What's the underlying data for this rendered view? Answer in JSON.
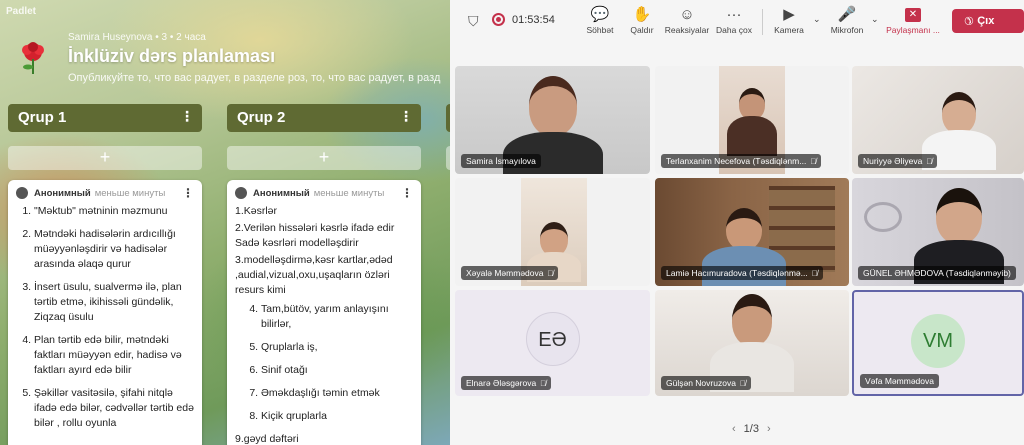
{
  "padlet": {
    "logo": "Padlet",
    "author_line": "Samira Huseynova • 3 • 2 часа",
    "title": "İnklüziv dərs planlaması",
    "subtitle": "Опубликуйте то, что вас радует, в разделе роз, то, что вас радует, в разд",
    "columns": [
      {
        "name": "Qrup 1",
        "menu": "⋮",
        "add": "+"
      },
      {
        "name": "Qrup 2",
        "menu": "⋮",
        "add": "+"
      }
    ],
    "cards": [
      {
        "author": "Анонимный",
        "time": "меньше минуты",
        "menu": "⋮",
        "items": [
          "\"Məktub\" mətninin məzmunu",
          "Mətndəki hadisələrin ardıcıllığı müəyyənləşdirir və hadisələr arasında əlaqə qurur",
          "İnsert üsulu, sualvermə ilə, plan tərtib etmə, ikihissəli gündəlik, Ziqzaq üsulu",
          "Plan tərtib edə bilir, mətndəki faktları müəyyən edir, hadisə və faktları ayırd edə bilir",
          "Şəkillər vasitəsilə, şifahi nitqlə ifadə edə bilər, cədvəllər tərtib edə bilər , rollu oyunla"
        ]
      },
      {
        "author": "Анонимный",
        "time": "меньше минуты",
        "menu": "⋮",
        "lines": [
          "1.Kəsrlər",
          "2.Verilən hissələri kəsrlə ifadə edir Sadə kəsrləri modelləşdirir",
          "3.modelləşdirmə,kəsr kartlar,ədəd ,audial,vizual,oxu,uşaqların özləri resurs kimi"
        ],
        "items": [
          "Tam,bütöv, yarım anlayışını bilirlər,",
          "Qruplarla iş,",
          "Sinif otağı",
          "Əməkdaşlığı təmin etmək",
          "Kiçik qruplarla"
        ],
        "last_line": "9.gəyd  dəftəri"
      }
    ]
  },
  "teams": {
    "timer": "01:53:54",
    "toolbar": [
      {
        "label": "Söhbət",
        "icon": "chat-icon",
        "glyph": "💬"
      },
      {
        "label": "Qaldır",
        "icon": "raise-hand-icon",
        "glyph": "✋"
      },
      {
        "label": "Reaksiyalar",
        "icon": "smile-icon",
        "glyph": "☺"
      },
      {
        "label": "Daha çox",
        "icon": "more-icon",
        "glyph": "···"
      },
      {
        "label": "Kamera",
        "icon": "camera-icon",
        "glyph": "▶"
      },
      {
        "label": "Mikrofon",
        "icon": "microphone-icon",
        "glyph": "🎤"
      },
      {
        "label": "Paylaşmanı ...",
        "icon": "stop-share-icon",
        "glyph": "✕"
      }
    ],
    "leave_label": "Çıx",
    "participants": [
      {
        "name": "Samira İsmayılova",
        "muted": false
      },
      {
        "name": "Terlanxanim Necefova (Təsdiqlənm...",
        "muted": true
      },
      {
        "name": "Nuriyyə Əliyeva",
        "muted": true
      },
      {
        "name": "Xəyalə Məmmədova",
        "muted": true
      },
      {
        "name": "Lamiə Hacımuradova (Təsdiqlənmə...",
        "muted": true
      },
      {
        "name": "GÜNEL ƏHMƏDOVA (Təsdiqlənməyib)",
        "muted": false
      },
      {
        "name": "Elnarə Ələsgərova",
        "muted": true,
        "initials": "EƏ"
      },
      {
        "name": "Gülşən Novruzova",
        "muted": true
      },
      {
        "name": "Vəfa Məmmədova",
        "muted": false,
        "initials": "VM"
      }
    ],
    "pager": {
      "prev": "‹",
      "page": "1/3",
      "next": "›"
    }
  },
  "colors": {
    "padlet_column": "#5f6a33",
    "teams_leave": "#c4314b",
    "vm_avatar": "#c8e6c9",
    "vm_text": "#2e7d32",
    "ee_avatar": "#e8e4ee",
    "ee_text": "#333333"
  }
}
